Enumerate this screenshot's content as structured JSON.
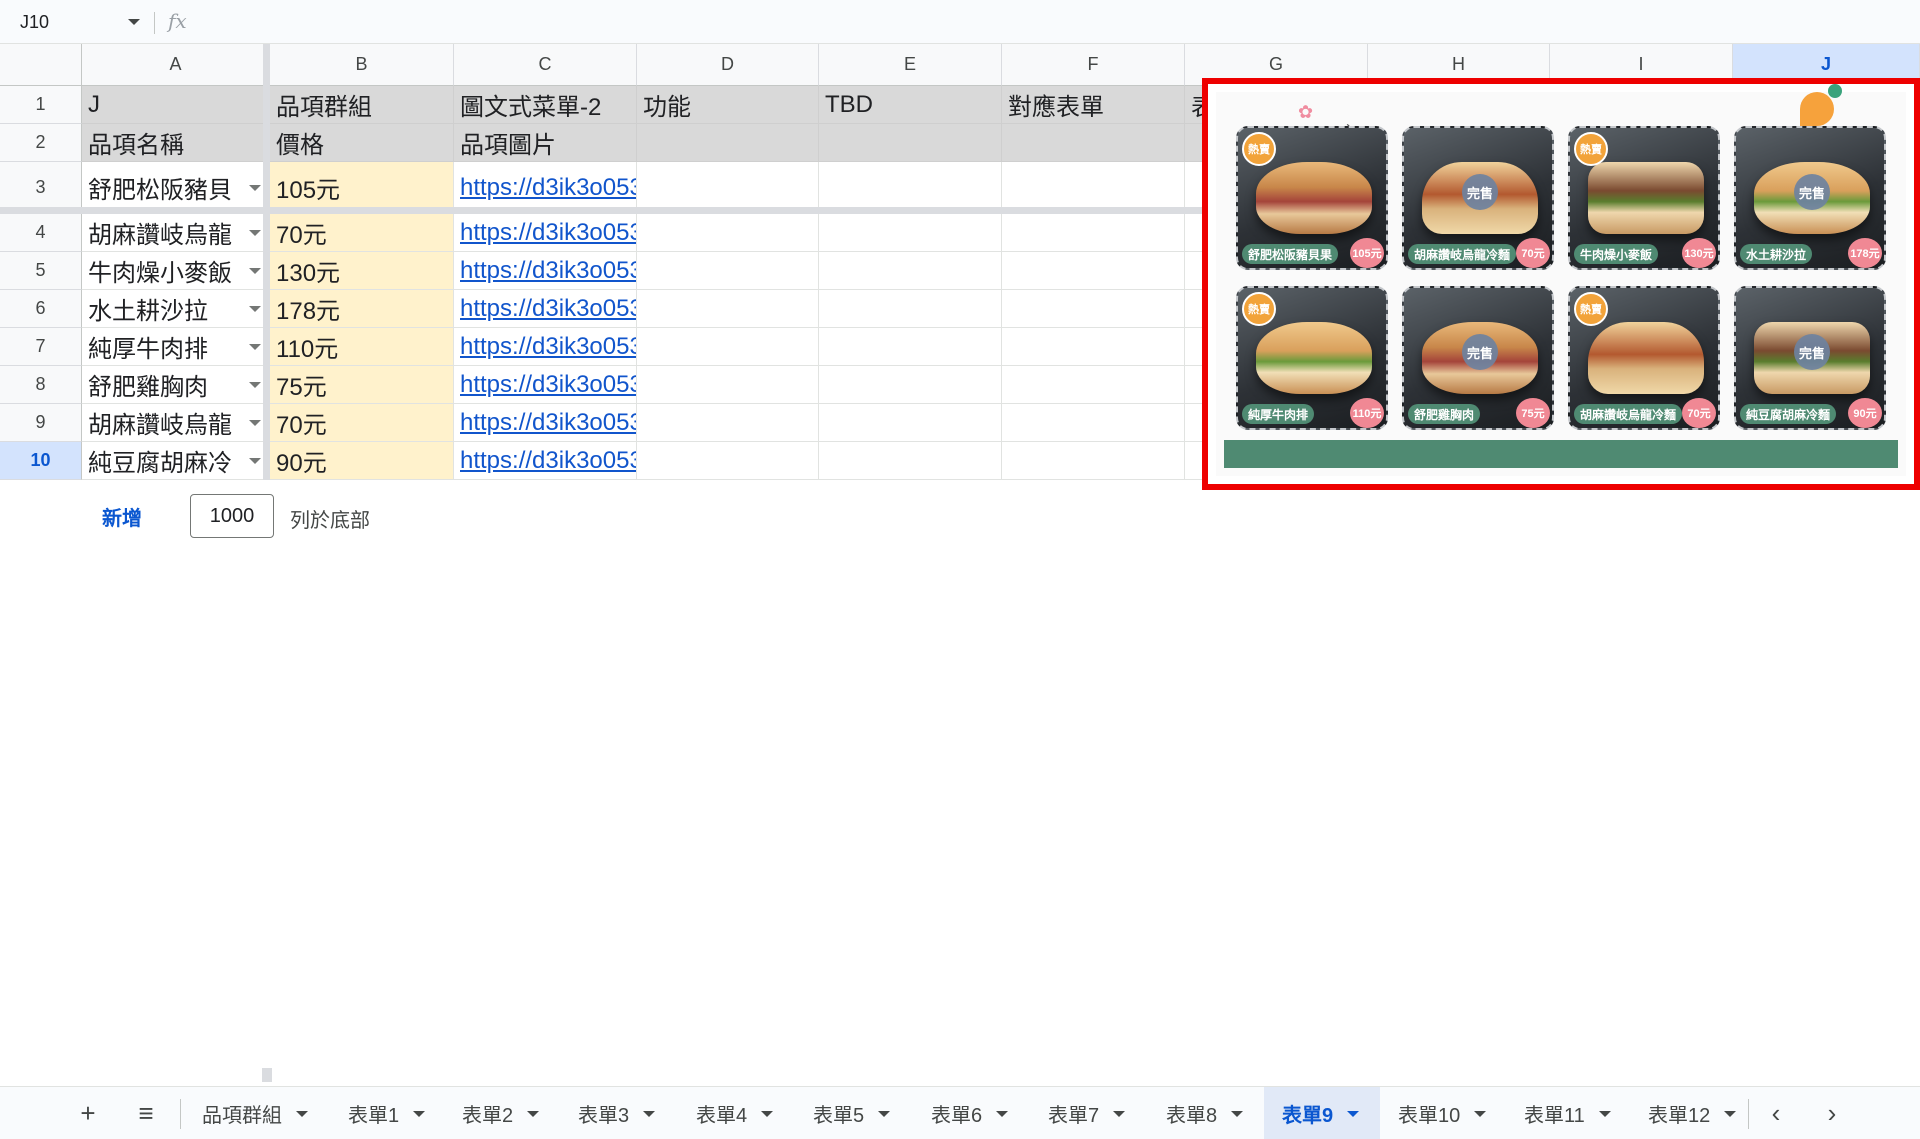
{
  "formula_bar": {
    "name_box": "J10",
    "fx_label": "fx"
  },
  "columns": [
    "A",
    "B",
    "C",
    "D",
    "E",
    "F",
    "G",
    "H",
    "I",
    "J"
  ],
  "rows": [
    "1",
    "2",
    "3",
    "4",
    "5",
    "6",
    "7",
    "8",
    "9",
    "10"
  ],
  "header_rows": {
    "row1": [
      "J",
      "品項群組",
      "圖文式菜單-2",
      "功能",
      "TBD",
      "對應表單",
      "表"
    ],
    "row2": [
      "品項名稱",
      "價格",
      "品項圖片",
      "",
      "",
      "",
      ""
    ]
  },
  "data_rows": [
    {
      "name": "舒肥松阪豬貝",
      "price": "105元",
      "image": "https://d3ik3o053"
    },
    {
      "name": "胡麻讚岐烏龍",
      "price": "70元",
      "image": "https://d3ik3o053"
    },
    {
      "name": "牛肉燥小麥飯",
      "price": "130元",
      "image": "https://d3ik3o053"
    },
    {
      "name": "水土耕沙拉",
      "price": "178元",
      "image": "https://d3ik3o053"
    },
    {
      "name": "純厚牛肉排",
      "price": "110元",
      "image": "https://d3ik3o053"
    },
    {
      "name": "舒肥雞胸肉",
      "price": "75元",
      "image": "https://d3ik3o053"
    },
    {
      "name": "胡麻讚岐烏龍",
      "price": "70元",
      "image": "https://d3ik3o053"
    },
    {
      "name": "純豆腐胡麻冷",
      "price": "90元",
      "image": "https://d3ik3o053"
    }
  ],
  "add_rows": {
    "button": "新增",
    "count": "1000",
    "suffix": "列於底部"
  },
  "menu_cards": [
    {
      "name": "舒肥松阪豬貝果",
      "price": "105元",
      "badge": "熱賣"
    },
    {
      "name": "胡麻讚岐烏龍冷麵",
      "price": "70元",
      "badge": "完售"
    },
    {
      "name": "牛肉燥小麥飯",
      "price": "130元",
      "badge": "熱賣"
    },
    {
      "name": "水土耕沙拉",
      "price": "178元",
      "badge": "完售"
    },
    {
      "name": "純厚牛肉排",
      "price": "110元",
      "badge": "熱賣"
    },
    {
      "name": "舒肥雞胸肉",
      "price": "75元",
      "badge": "完售"
    },
    {
      "name": "胡麻讚岐烏龍冷麵",
      "price": "70元",
      "badge": "熱賣"
    },
    {
      "name": "純豆腐胡麻冷麵",
      "price": "90元",
      "badge": "完售"
    }
  ],
  "sheet_tabs": [
    "品項群組",
    "表單1",
    "表單2",
    "表單3",
    "表單4",
    "表單5",
    "表單6",
    "表單7",
    "表單8",
    "表單9",
    "表單10",
    "表單11",
    "表單12"
  ],
  "active_tab": "表單9",
  "colors": {
    "accent": "#0b57d0",
    "highlight_border": "#ee0000",
    "price_fill": "#fff2cc",
    "card_green": "#4f8a72",
    "hot_badge": "#f2a33a",
    "price_badge": "#f08894"
  }
}
